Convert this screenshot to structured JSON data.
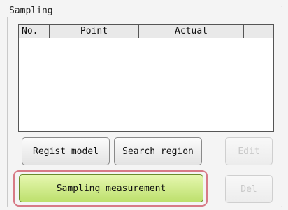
{
  "group": {
    "title": "Sampling"
  },
  "table": {
    "columns": [
      "No.",
      "Point",
      "Actual",
      ""
    ],
    "rows": []
  },
  "buttons": {
    "regist_model": "Regist model",
    "search_region": "Search region",
    "edit": "Edit",
    "sampling_measurement": "Sampling measurement",
    "del": "Del"
  },
  "colors": {
    "highlight_border": "#d77a86",
    "sampling_button_fill": "#c9e97f"
  }
}
